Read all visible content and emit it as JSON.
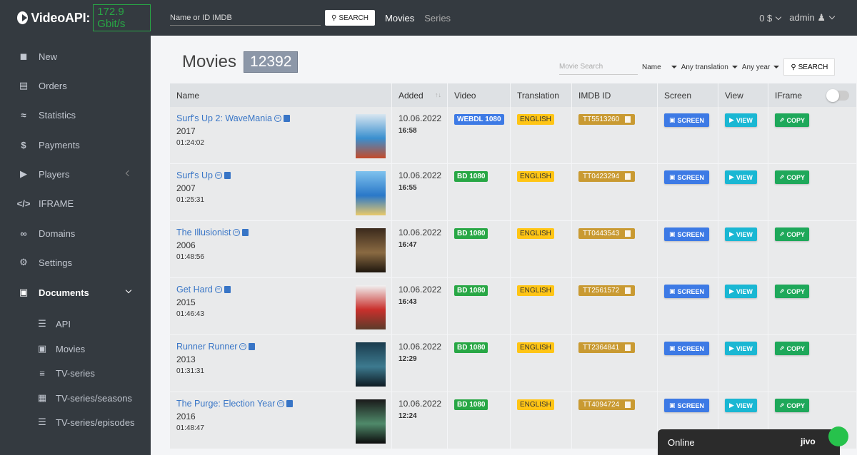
{
  "brand": {
    "name": "VideoAPI:",
    "speed": "172.9 Gbit/s"
  },
  "topbar": {
    "search_placeholder": "Name or ID IMDB",
    "search_button": "SEARCH",
    "nav_movies": "Movies",
    "nav_series": "Series",
    "balance": "0 $",
    "user": "admin"
  },
  "sidebar": {
    "items": [
      {
        "label": "New",
        "icon": "video-camera-icon"
      },
      {
        "label": "Orders",
        "icon": "inbox-icon"
      },
      {
        "label": "Statistics",
        "icon": "chart-line-icon"
      },
      {
        "label": "Payments",
        "icon": "dollar-icon"
      },
      {
        "label": "Players",
        "icon": "play-circle-icon"
      },
      {
        "label": "IFRAME",
        "icon": "code-icon"
      },
      {
        "label": "Domains",
        "icon": "link-icon"
      },
      {
        "label": "Settings",
        "icon": "gear-icon"
      },
      {
        "label": "Documents",
        "icon": "cube-icon"
      }
    ],
    "subitems": [
      {
        "label": "API",
        "icon": "database-icon"
      },
      {
        "label": "Movies",
        "icon": "cube-icon"
      },
      {
        "label": "TV-series",
        "icon": "layers-icon"
      },
      {
        "label": "TV-series/seasons",
        "icon": "cubes-icon"
      },
      {
        "label": "TV-series/episodes",
        "icon": "database-icon"
      }
    ]
  },
  "page": {
    "title": "Movies",
    "count": "12392"
  },
  "filters": {
    "search_placeholder": "Movie Search",
    "sort": "Name",
    "translation": "Any translation",
    "year": "Any year",
    "button": "SEARCH"
  },
  "table": {
    "headers": {
      "name": "Name",
      "added": "Added",
      "video": "Video",
      "translation": "Translation",
      "imdb": "IMDB ID",
      "screen": "Screen",
      "view": "View",
      "iframe": "IFrame"
    },
    "rows": [
      {
        "title": "Surf's Up 2: WaveMania",
        "year": "2017",
        "duration": "01:24:02",
        "date": "10.06.2022",
        "time": "16:58",
        "video": "WEBDL 1080",
        "translation": "ENGLISH",
        "imdb": "TT5513260",
        "poster": [
          "#d8e6f0",
          "#3a8fcf",
          "#c44a2a"
        ]
      },
      {
        "title": "Surf's Up",
        "year": "2007",
        "duration": "01:25:31",
        "date": "10.06.2022",
        "time": "16:55",
        "video": "BD 1080",
        "translation": "ENGLISH",
        "imdb": "TT0423294",
        "poster": [
          "#7fc2ee",
          "#2a78c8",
          "#e9c96a"
        ]
      },
      {
        "title": "The Illusionist",
        "year": "2006",
        "duration": "01:48:56",
        "date": "10.06.2022",
        "time": "16:47",
        "video": "BD 1080",
        "translation": "ENGLISH",
        "imdb": "TT0443543",
        "poster": [
          "#3b2a1c",
          "#8a6a42",
          "#1e160e"
        ]
      },
      {
        "title": "Get Hard",
        "year": "2015",
        "duration": "01:46:43",
        "date": "10.06.2022",
        "time": "16:43",
        "video": "BD 1080",
        "translation": "ENGLISH",
        "imdb": "TT2561572",
        "poster": [
          "#f1f1f1",
          "#c9302c",
          "#5b3b2a"
        ]
      },
      {
        "title": "Runner Runner",
        "year": "2013",
        "duration": "01:31:31",
        "date": "10.06.2022",
        "time": "12:29",
        "video": "BD 1080",
        "translation": "ENGLISH",
        "imdb": "TT2364841",
        "poster": [
          "#1a3b4d",
          "#3d7a8f",
          "#0d1a22"
        ]
      },
      {
        "title": "The Purge: Election Year",
        "year": "2016",
        "duration": "01:48:47",
        "date": "10.06.2022",
        "time": "12:24",
        "video": "BD 1080",
        "translation": "ENGLISH",
        "imdb": "TT4094724",
        "poster": [
          "#1a1a1a",
          "#4f8a6a",
          "#0c0c0c"
        ]
      }
    ],
    "screen_label": "SCREEN",
    "view_label": "VIEW",
    "copy_label": "COPY"
  },
  "chat": {
    "status": "Online",
    "logo": "jivo"
  }
}
